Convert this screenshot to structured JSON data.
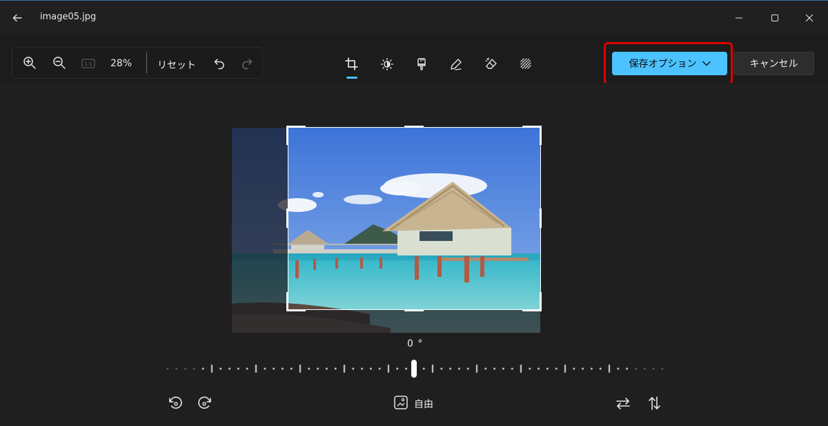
{
  "window": {
    "title": "image05.jpg",
    "back_icon": "back-arrow-icon",
    "minimize_icon": "minimize-icon",
    "maximize_icon": "maximize-icon",
    "close_icon": "close-icon"
  },
  "zoom_panel": {
    "zoom_in_icon": "zoom-in-icon",
    "zoom_out_icon": "zoom-out-icon",
    "actual_size_icon": "actual-size-icon",
    "actual_size_label": "1:1",
    "zoom_value": "28%",
    "reset_label": "リセット",
    "undo_icon": "undo-icon",
    "redo_icon": "redo-icon"
  },
  "tools": [
    {
      "name": "crop",
      "icon": "crop-icon",
      "active": true
    },
    {
      "name": "adjust",
      "icon": "brightness-icon",
      "active": false
    },
    {
      "name": "filter",
      "icon": "filter-brush-icon",
      "active": false
    },
    {
      "name": "markup",
      "icon": "pen-icon",
      "active": false
    },
    {
      "name": "erase",
      "icon": "eraser-icon",
      "active": false
    },
    {
      "name": "background",
      "icon": "background-blur-icon",
      "active": false
    }
  ],
  "actions": {
    "save_label": "保存オプション",
    "cancel_label": "キャンセル"
  },
  "colors": {
    "accent": "#4cc2ff",
    "highlight": "#e00000",
    "background": "#1f1f1f"
  },
  "rotation": {
    "angle_label": "0 °",
    "angle_value": 0
  },
  "bottom_bar": {
    "rotate_left_icon": "rotate-left-icon",
    "rotate_right_icon": "rotate-right-icon",
    "aspect_icon": "aspect-ratio-icon",
    "aspect_label": "自由",
    "flip_horizontal_icon": "flip-horizontal-icon",
    "flip_vertical_icon": "flip-vertical-icon"
  }
}
